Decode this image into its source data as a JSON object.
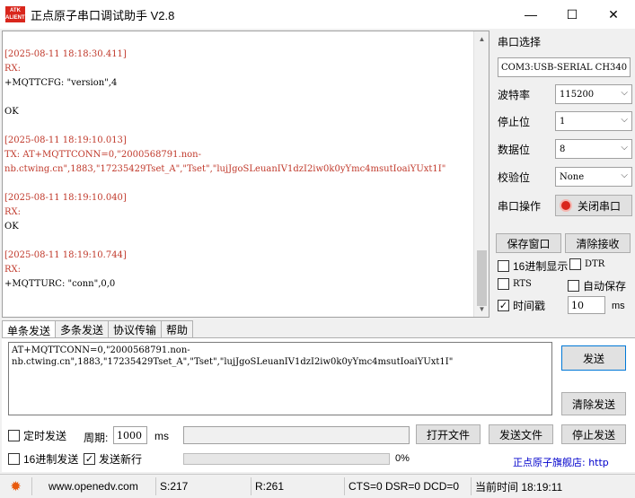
{
  "window": {
    "logo_text": "ATK ALIENTEK",
    "title": "正点原子串口调试助手 V2.8",
    "minimize_glyph": "—",
    "maximize_glyph": "☐",
    "close_glyph": "✕"
  },
  "log": {
    "entries": [
      {
        "timestamp": "[2025-08-11 18:18:30.411]",
        "direction": "RX:",
        "lines": [
          "+MQTTCFG: \"version\",4",
          "",
          "OK"
        ]
      },
      {
        "timestamp": "[2025-08-11 18:19:10.013]",
        "direction": "TX: AT+MQTTCONN=0,\"2000568791.non-",
        "lines": [
          "nb.ctwing.cn\",1883,\"17235429Tset_A\",\"Tset\",\"lujJgoSLeuanIV1dzI2iw0k0yYmc4msutIoaiYUxt1I\""
        ]
      },
      {
        "timestamp": "[2025-08-11 18:19:10.040]",
        "direction": "RX:",
        "lines": [
          "OK"
        ]
      },
      {
        "timestamp": "[2025-08-11 18:19:10.744]",
        "direction": "RX:",
        "lines": [
          "+MQTTURC: \"conn\",0,0"
        ]
      }
    ]
  },
  "serial": {
    "port_select_label": "串口选择",
    "port_value": "COM3:USB-SERIAL CH340",
    "baud_label": "波特率",
    "baud_value": "115200",
    "stopbits_label": "停止位",
    "stopbits_value": "1",
    "databits_label": "数据位",
    "databits_value": "8",
    "parity_label": "校验位",
    "parity_value": "None",
    "operation_label": "串口操作",
    "close_port_button": "关闭串口",
    "save_window_button": "保存窗口",
    "clear_receive_button": "清除接收",
    "hex_display_label": "16进制显示",
    "dtr_label": "DTR",
    "rts_label": "RTS",
    "auto_save_label": "自动保存",
    "timestamp_label": "时间戳",
    "timestamp_value": "10",
    "timestamp_unit": "ms"
  },
  "tabs": [
    "单条发送",
    "多条发送",
    "协议传输",
    "帮助"
  ],
  "send": {
    "text_line1": "AT+MQTTCONN=0,\"2000568791.non-",
    "text_line2": "nb.ctwing.cn\",1883,\"17235429Tset_A\",\"Tset\",\"lujJgoSLeuanIV1dzI2iw0k0yYmc4msutIoaiYUxt1I\"",
    "send_button": "发送",
    "clear_send_button": "清除发送",
    "timed_send_label": "定时发送",
    "period_label": "周期:",
    "period_value": "1000",
    "period_unit": "ms",
    "open_file_button": "打开文件",
    "send_file_button": "发送文件",
    "stop_send_button": "停止发送",
    "hex_send_label": "16进制发送",
    "send_newline_label": "发送新行",
    "progress_percent": 0,
    "progress_text": "0%",
    "brand_link": "正点原子旗舰店: http"
  },
  "status": {
    "gear_glyph": "✹",
    "website": "www.openedv.com",
    "sent": "S:217",
    "received": "R:261",
    "signals": "CTS=0 DSR=0 DCD=0",
    "time": "当前时间 18:19:11"
  },
  "colors": {
    "timestamp_red": "#c0392b",
    "close_button_red": "#d9261c",
    "brand_link_blue": "#0000cc"
  }
}
